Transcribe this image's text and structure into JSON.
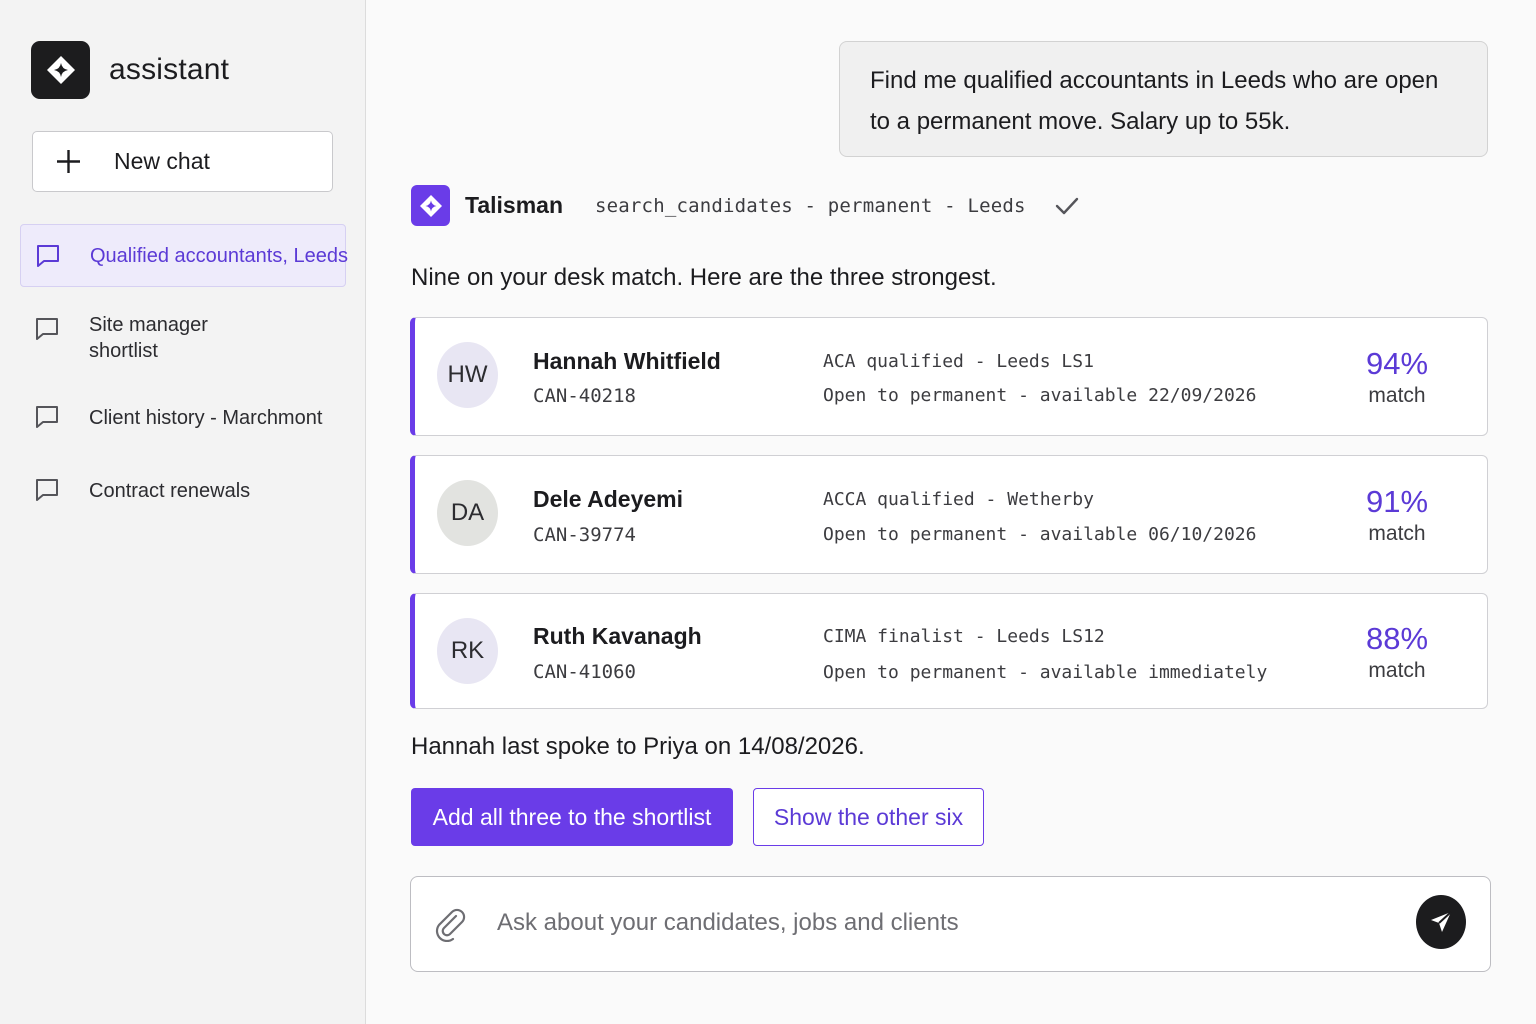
{
  "app": {
    "name": "assistant"
  },
  "sidebar": {
    "new_chat_label": "New chat",
    "history": [
      {
        "label": "Qualified accountants, Leeds",
        "active": true
      },
      {
        "label_line1": "Site manager",
        "label_line2": "shortlist",
        "active": false
      },
      {
        "label": "Client history - Marchmont",
        "active": false
      },
      {
        "label": "Contract renewals",
        "active": false
      }
    ]
  },
  "conversation": {
    "user_message_line1": "Find me qualified accountants in Leeds who are open",
    "user_message_line2": "to a permanent move. Salary up to 55k.",
    "assistant_name": "Talisman",
    "tool_call": "search_candidates - permanent - Leeds",
    "tool_status_icon": "check-icon",
    "intro": "Nine on your desk match. Here are the three strongest.",
    "candidates": [
      {
        "initials": "HW",
        "name": "Hannah Whitfield",
        "id": "CAN-40218",
        "qualification": "ACA qualified - Leeds LS1",
        "availability": "Open to permanent - available 22/09/2026",
        "match_pct": "94%",
        "match_label": "match",
        "avatar_color": "#e8e6f3"
      },
      {
        "initials": "DA",
        "name": "Dele Adeyemi",
        "id": "CAN-39774",
        "qualification": "ACCA qualified - Wetherby",
        "availability": "Open to permanent - available 06/10/2026",
        "match_pct": "91%",
        "match_label": "match",
        "avatar_color": "#e2e3e0"
      },
      {
        "initials": "RK",
        "name": "Ruth Kavanagh",
        "id": "CAN-41060",
        "qualification": "CIMA finalist - Leeds LS12",
        "availability": "Open to permanent - available immediately",
        "match_pct": "88%",
        "match_label": "match",
        "avatar_color": "#e8e6f3"
      }
    ],
    "footnote": "Hannah last spoke to Priya on 14/08/2026.",
    "actions": {
      "primary": "Add all three to the shortlist",
      "secondary": "Show the other six"
    }
  },
  "composer": {
    "placeholder": "Ask about your candidates, jobs and clients",
    "value": ""
  },
  "colors": {
    "accent": "#6a3ce8",
    "accent_text": "#5b3ad6",
    "dark": "#1c1c1e"
  }
}
